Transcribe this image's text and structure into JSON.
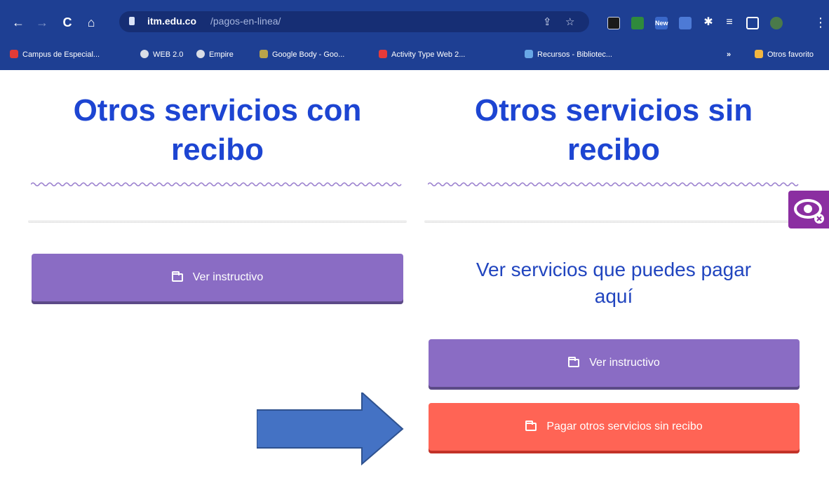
{
  "browser": {
    "url_host": "itm.edu.co",
    "url_path": "/pagos-en-linea/",
    "extensions": [
      {
        "name": "ext-1",
        "color": "#1a1a1a",
        "label": ""
      },
      {
        "name": "ext-2",
        "color": "#2f8a3c",
        "label": ""
      },
      {
        "name": "ext-3",
        "color": "#3a68c9",
        "label": "New"
      },
      {
        "name": "ext-4",
        "color": "#4d7ad6",
        "label": ""
      }
    ],
    "bookmarks": [
      {
        "label": "Campus de Especial...",
        "color": "#e33b36"
      },
      {
        "label": "WEB 2.0",
        "color": "#d9dde6"
      },
      {
        "label": "Empire",
        "color": "#d9dde6"
      },
      {
        "label": "Google Body - Goo...",
        "color": "#b9a44a"
      },
      {
        "label": "Activity Type Web 2...",
        "color": "#e63a3a"
      },
      {
        "label": "Recursos - Bibliotec...",
        "color": "#68a7e6"
      }
    ],
    "more_bookmarks": "»",
    "other_favorites": "Otros favorito"
  },
  "left": {
    "heading_line1": "Otros servicios con",
    "heading_line2": "recibo",
    "button_label": "Ver instructivo"
  },
  "right": {
    "heading_line1": "Otros servicios sin",
    "heading_line2": "recibo",
    "subtitle_line1": "Ver servicios que puedes pagar",
    "subtitle_line2": "aquí",
    "instructivo_label": "Ver instructivo",
    "pay_label": "Pagar otros servicios sin recibo"
  },
  "colors": {
    "heading": "#1d45d2",
    "purple_button": "#8a6cc4",
    "red_button": "#ff6455",
    "arrow": "#4472c4"
  }
}
